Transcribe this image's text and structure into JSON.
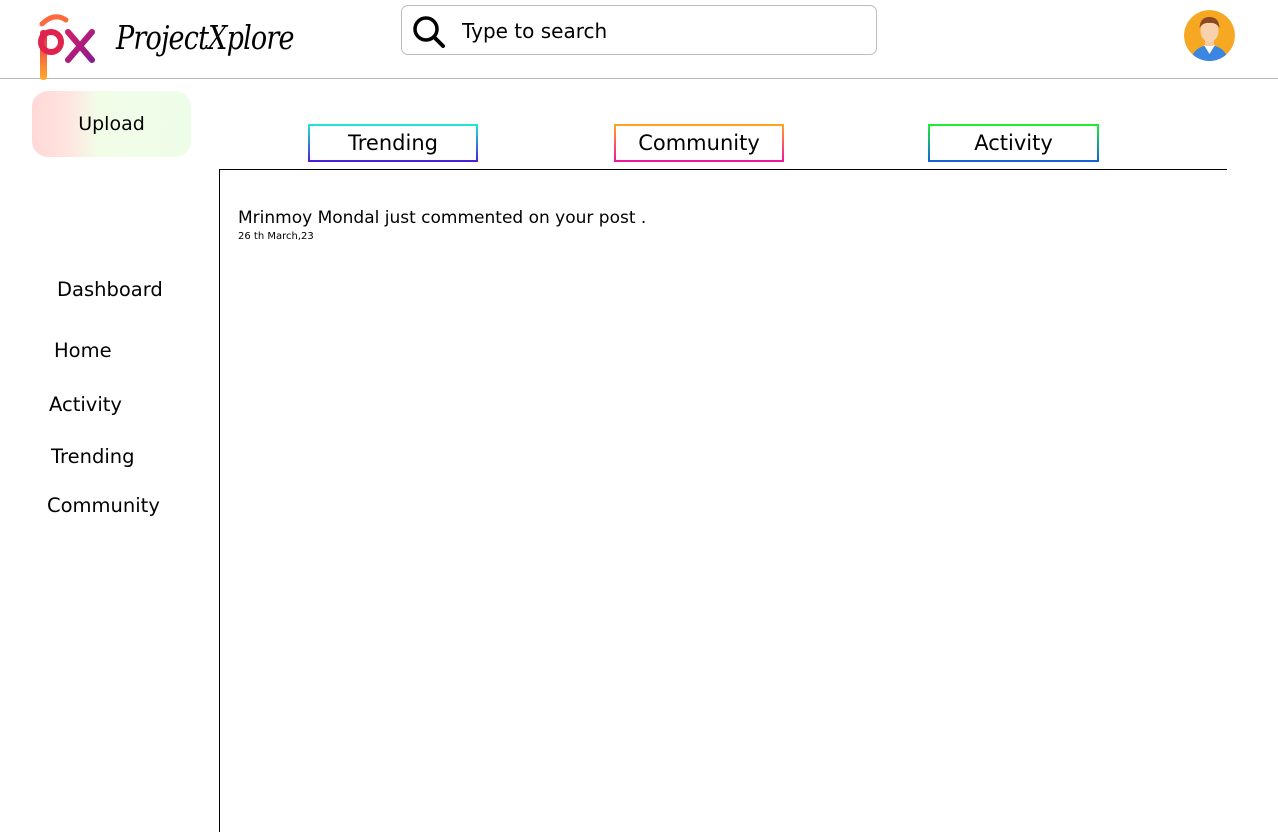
{
  "app": {
    "logo_text": "px",
    "brand_name": "ProjectXplore"
  },
  "search": {
    "placeholder": "Type to search",
    "icon": "search-icon"
  },
  "user": {
    "avatar_icon": "user-avatar"
  },
  "upload": {
    "label": "Upload"
  },
  "sidebar": {
    "items": [
      {
        "label": "Dashboard"
      },
      {
        "label": "Home"
      },
      {
        "label": "Activity"
      },
      {
        "label": "Trending"
      },
      {
        "label": "Community"
      }
    ]
  },
  "tabs": [
    {
      "label": "Trending"
    },
    {
      "label": "Community"
    },
    {
      "label": "Activity"
    }
  ],
  "notifications": [
    {
      "text": "Mrinmoy Mondal just commented on your post .",
      "date": "26 th March,23"
    }
  ],
  "colors": {
    "tab_trending": [
      "#22e6d6",
      "#4b1fd8"
    ],
    "tab_community": [
      "#ffa41f",
      "#f0169e"
    ],
    "tab_activity": [
      "#1cf02e",
      "#1560d8"
    ],
    "upload_gradient": [
      "#ffd8d8",
      "#eefde8"
    ]
  }
}
